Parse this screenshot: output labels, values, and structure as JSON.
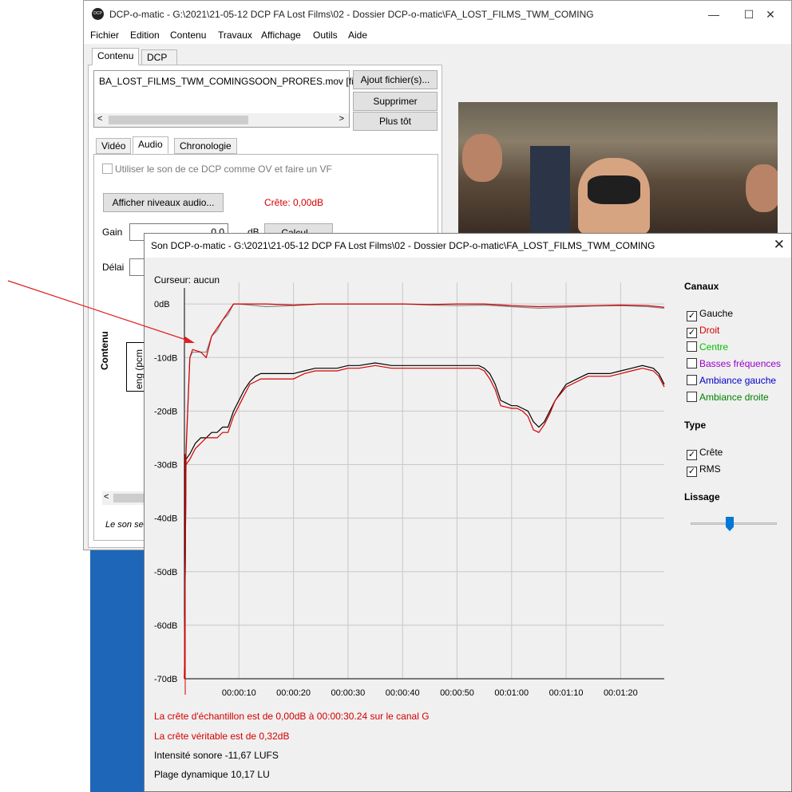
{
  "main": {
    "title": "DCP-o-matic - G:\\2021\\21-05-12 DCP FA Lost Films\\02 - Dossier DCP-o-matic\\FA_LOST_FILMS_TWM_COMING",
    "icon_text": "DCP",
    "menus": [
      "Fichier",
      "Edition",
      "Contenu",
      "Travaux",
      "Affichage",
      "Outils",
      "Aide"
    ],
    "tabs": [
      "Contenu",
      "DCP"
    ],
    "content_file": "BA_LOST_FILMS_TWM_COMINGSOON_PRORES.mov [film]",
    "buttons": {
      "add_file": "Ajout fichier(s)...",
      "remove": "Supprimer",
      "earlier": "Plus tôt"
    },
    "subtabs": [
      "Vidéo",
      "Audio",
      "Chronologie"
    ],
    "use_ov_label": "Utiliser le son de ce DCP comme OV et faire un VF",
    "show_levels": "Afficher niveaux audio...",
    "peak": "Crête: 0,00dB",
    "gain_label": "Gain",
    "gain_value": "0.0",
    "gain_unit": "dB",
    "calc_button": "Calcul...",
    "delay_label": "Délai",
    "content_vertical": "Contenu",
    "stream_vertical": "eng (pcm",
    "footer_note": "Le son sera"
  },
  "dialog": {
    "title": "Son DCP-o-matic - G:\\2021\\21-05-12 DCP FA Lost Films\\02 - Dossier DCP-o-matic\\FA_LOST_FILMS_TWM_COMING",
    "cursor": "Curseur: aucun",
    "channels_title": "Canaux",
    "channels": [
      {
        "label": "Gauche",
        "checked": true,
        "color": "#000000"
      },
      {
        "label": "Droit",
        "checked": true,
        "color": "#d40000"
      },
      {
        "label": "Centre",
        "checked": false,
        "color": "#00c000"
      },
      {
        "label": "Basses fréquences",
        "checked": false,
        "color": "#9a00c8"
      },
      {
        "label": "Ambiance gauche",
        "checked": false,
        "color": "#0000c8"
      },
      {
        "label": "Ambiance droite",
        "checked": false,
        "color": "#008000"
      }
    ],
    "type_title": "Type",
    "types": [
      {
        "label": "Crête",
        "checked": true
      },
      {
        "label": "RMS",
        "checked": true
      }
    ],
    "smoothing_title": "Lissage",
    "smoothing_level": 0.5,
    "info": {
      "sample_peak": "La crête d'échantillon est de 0,00dB à 00:00:30.24 sur le canal G",
      "true_peak": "La crête véritable est de 0,32dB",
      "loudness": "Intensité sonore -11,67 LUFS",
      "dynamic_range": "Plage dynamique 10,17 LU"
    },
    "info_color": "#d40000"
  },
  "chart_data": {
    "type": "line",
    "xlabel": "",
    "ylabel": "",
    "x_ticks": [
      "00:00:10",
      "00:00:20",
      "00:00:30",
      "00:00:40",
      "00:00:50",
      "00:01:00",
      "00:01:10",
      "00:01:20"
    ],
    "y_ticks": [
      "0dB",
      "-10dB",
      "-20dB",
      "-30dB",
      "-40dB",
      "-50dB",
      "-60dB",
      "-70dB"
    ],
    "xlim": [
      0,
      88
    ],
    "ylim": [
      -70,
      3
    ],
    "grid": true,
    "series": [
      {
        "name": "Gauche RMS",
        "color": "#000000",
        "x": [
          0,
          0.3,
          1,
          2,
          3,
          4,
          5,
          6,
          7,
          8,
          9,
          10,
          11,
          12,
          13,
          14,
          16,
          18,
          20,
          22,
          24,
          26,
          28,
          30,
          32,
          35,
          38,
          40,
          42,
          45,
          48,
          50,
          52,
          54,
          55,
          56,
          57,
          58,
          60,
          61,
          62,
          63,
          64,
          65,
          66,
          67,
          68,
          70,
          72,
          74,
          76,
          78,
          80,
          82,
          84,
          86,
          87,
          88
        ],
        "y": [
          -70,
          -29,
          -28,
          -26,
          -25,
          -25,
          -24,
          -24,
          -23,
          -23,
          -20,
          -18,
          -16,
          -14.5,
          -13.5,
          -13,
          -13,
          -13,
          -13,
          -12.5,
          -12,
          -12,
          -12,
          -11.5,
          -11.5,
          -11,
          -11.5,
          -11.5,
          -11.5,
          -11.5,
          -11.5,
          -11.5,
          -11.5,
          -11.5,
          -12,
          -13,
          -15,
          -18,
          -19,
          -19,
          -19.5,
          -20,
          -22,
          -23,
          -22,
          -20,
          -18,
          -15,
          -14,
          -13,
          -13,
          -13,
          -12.5,
          -12,
          -11.5,
          -12,
          -13,
          -15
        ]
      },
      {
        "name": "Droit RMS",
        "color": "#d40000",
        "x": [
          0,
          0.3,
          1,
          2,
          3,
          4,
          5,
          6,
          7,
          8,
          9,
          10,
          11,
          12,
          13,
          14,
          16,
          18,
          20,
          22,
          24,
          26,
          28,
          30,
          32,
          35,
          38,
          40,
          42,
          45,
          48,
          50,
          52,
          54,
          55,
          56,
          57,
          58,
          60,
          61,
          62,
          63,
          64,
          65,
          66,
          67,
          68,
          70,
          72,
          74,
          76,
          78,
          80,
          82,
          84,
          86,
          87,
          88
        ],
        "y": [
          -70,
          -30,
          -29,
          -27,
          -26,
          -25,
          -25,
          -25,
          -24,
          -24,
          -21,
          -19,
          -17,
          -15,
          -14.5,
          -14,
          -14,
          -14,
          -14,
          -13,
          -12.5,
          -12.5,
          -12.5,
          -12,
          -12,
          -11.5,
          -12,
          -12,
          -12,
          -12,
          -12,
          -12,
          -12,
          -12,
          -12.5,
          -14,
          -16,
          -19,
          -19.5,
          -19.5,
          -20,
          -21,
          -23.5,
          -24,
          -22.5,
          -20.5,
          -18,
          -15.5,
          -14.5,
          -13.5,
          -13.5,
          -13.5,
          -13,
          -12.5,
          -12,
          -12.5,
          -13.5,
          -15.5
        ]
      },
      {
        "name": "Gauche Crête",
        "color": "#8a8a8a",
        "x": [
          0,
          0.3,
          1,
          1.5,
          3,
          4,
          5,
          6,
          7,
          8,
          9,
          10,
          15,
          20,
          25,
          30,
          35,
          40,
          45,
          50,
          55,
          60,
          65,
          70,
          75,
          80,
          85,
          88
        ],
        "y": [
          -70,
          -27,
          -10,
          -9,
          -9,
          -9,
          -6,
          -5,
          -3,
          -2,
          0,
          0,
          -0.5,
          -0.3,
          0,
          0,
          0,
          0,
          -0.2,
          -0.3,
          -0.2,
          -0.5,
          -0.8,
          -0.6,
          -0.4,
          -0.3,
          -0.5,
          -0.8
        ]
      },
      {
        "name": "Droit Crête",
        "color": "#d40000",
        "x": [
          0,
          0.3,
          1,
          1.5,
          3,
          4,
          5,
          6,
          7,
          8,
          9,
          10,
          15,
          20,
          25,
          30,
          35,
          40,
          45,
          50,
          55,
          60,
          65,
          70,
          75,
          80,
          85,
          88
        ],
        "y": [
          -70,
          -28,
          -10,
          -8.5,
          -9,
          -10,
          -6,
          -4.5,
          -3,
          -1.5,
          0,
          0,
          0,
          -0.2,
          0,
          0,
          0,
          0,
          -0.1,
          0,
          0,
          -0.3,
          -0.5,
          -0.4,
          -0.3,
          -0.2,
          -0.3,
          -0.6
        ]
      }
    ]
  }
}
